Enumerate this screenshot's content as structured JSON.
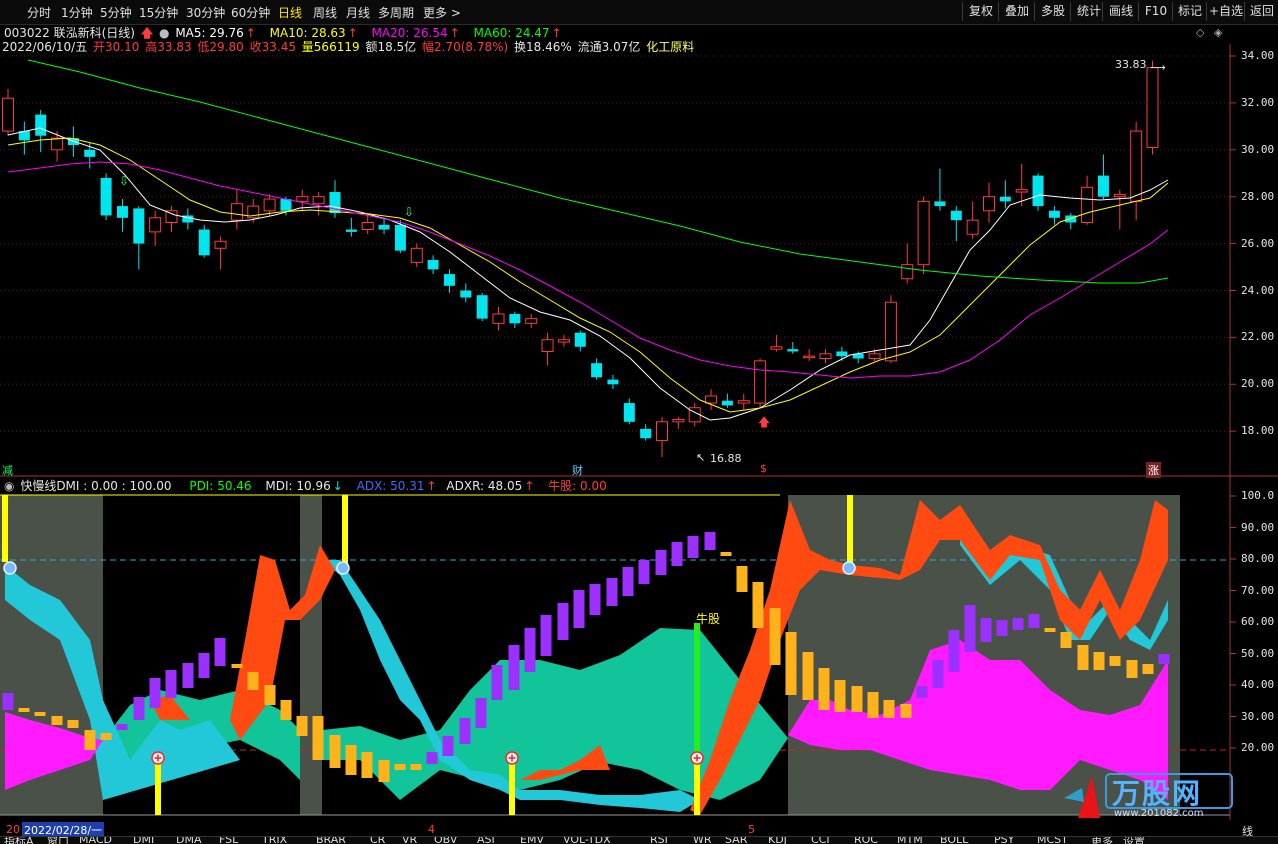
{
  "timeframes": [
    {
      "label": "分时",
      "active": false
    },
    {
      "label": "1分钟",
      "active": false
    },
    {
      "label": "5分钟",
      "active": false
    },
    {
      "label": "15分钟",
      "active": false
    },
    {
      "label": "30分钟",
      "active": false
    },
    {
      "label": "60分钟",
      "active": false
    },
    {
      "label": "日线",
      "active": true
    },
    {
      "label": "周线",
      "active": false
    },
    {
      "label": "月线",
      "active": false
    },
    {
      "label": "多周期",
      "active": false
    },
    {
      "label": "更多 >",
      "active": false
    }
  ],
  "right_buttons": [
    "复权",
    "叠加",
    "多股",
    "统计",
    "画线",
    "F10",
    "标记",
    "+自选",
    "返回"
  ],
  "stock": {
    "code_name": "003022 联泓新科(日线)",
    "ma5": "MA5: 29.76",
    "ma10": "MA10: 28.63",
    "ma20": "MA20: 26.54",
    "ma60": "MA60: 24.47",
    "date": "2022/06/10/五",
    "open": "开30.10",
    "high": "高33.83",
    "low": "低29.80",
    "close": "收33.45",
    "volume": "量566119",
    "amount": "额18.5亿",
    "change": "幅2.70(8.78%)",
    "turnover": "换18.46%",
    "float": "流通3.07亿",
    "industry": "化工原料"
  },
  "price_axis": [
    "34.00",
    "32.00",
    "30.00",
    "28.00",
    "26.00",
    "24.00",
    "22.00",
    "20.00",
    "18.00"
  ],
  "price_marks": {
    "high": "33.83",
    "low": "16.88"
  },
  "markers": {
    "left": "减",
    "mid": "财",
    "dollar": "$",
    "right": "涨"
  },
  "indicator": {
    "name": "快慢线DMI : 0.00 : 100.00",
    "pdi": "PDI: 50.46",
    "mdi": "MDI: 10.96",
    "adx": "ADX: 50.31",
    "adxr": "ADXR: 48.05",
    "niugu": "牛股: 0.00",
    "tag_label": "牛股"
  },
  "ind_axis": [
    "100.0",
    "90.00",
    "80.00",
    "70.00",
    "60.00",
    "50.00",
    "40.00",
    "30.00",
    "20.00"
  ],
  "time_axis": {
    "prefix": "20",
    "date": "2022/02/28/一",
    "m4": "4",
    "m5": "5",
    "end": "线"
  },
  "bottom_tabs": [
    "指标A",
    "窗口",
    "MACD",
    "DMI",
    "DMA",
    "FSL",
    "TRIX",
    "BRAR",
    "CR",
    "VR",
    "OBV",
    "ASI",
    "EMV",
    "VOL-TDX",
    "RSI",
    "WR",
    "SAR",
    "KDJ",
    "CCI",
    "ROC",
    "MTM",
    "BOLL",
    "PSY",
    "MCST",
    "更多",
    "设置"
  ],
  "watermark": {
    "brand": "万股网",
    "url": "www.201082.com"
  },
  "colors": {
    "up": "#ff3b3b",
    "down": "#00e5ee",
    "ma5": "#ffffff",
    "ma10": "#ffff00",
    "ma20": "#ff00ff",
    "ma60": "#00ff00",
    "pdi": "#00ff00",
    "mdi": "#e6e6e6",
    "adx": "#3f6bff",
    "adxr": "#e6e6e6",
    "niugu": "#ff3b3b"
  }
}
